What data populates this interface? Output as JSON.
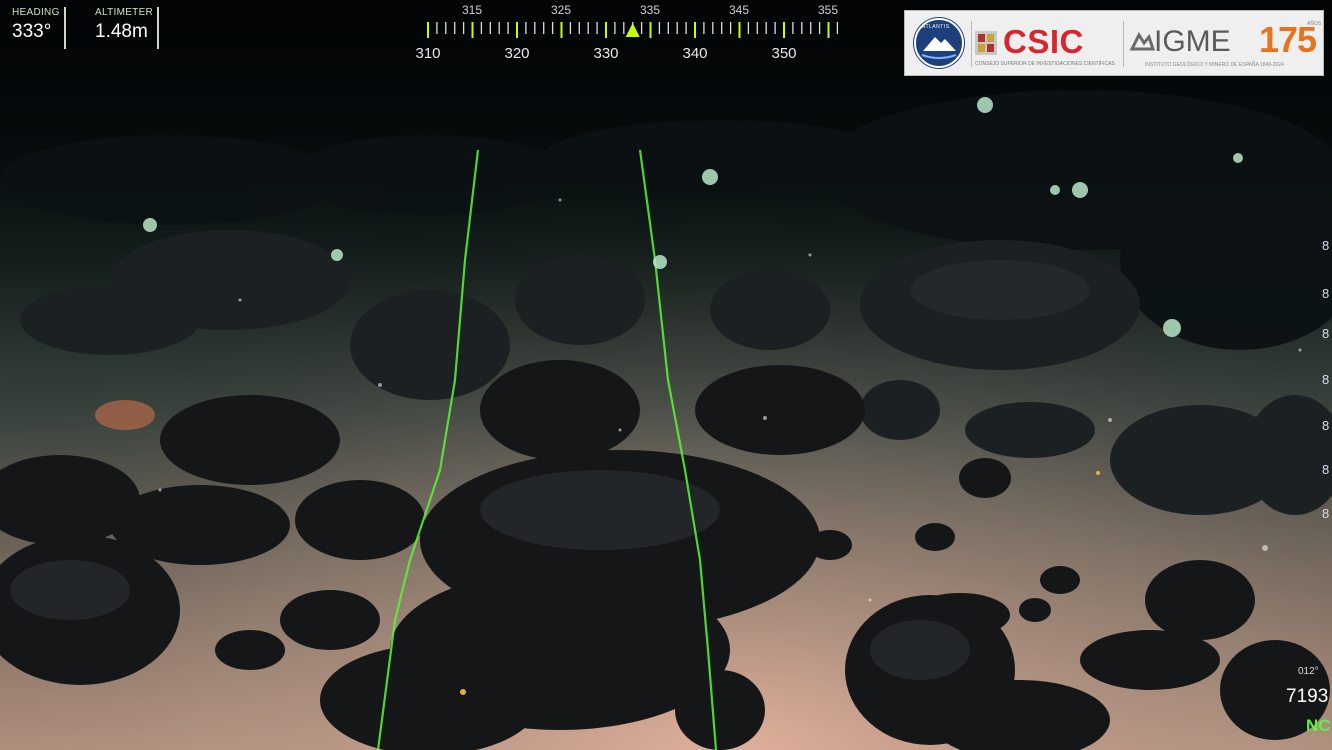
{
  "hud": {
    "heading_label": "HEADING",
    "heading_value": "333°",
    "altimeter_label": "ALTIMETER",
    "altimeter_value": "1.48m"
  },
  "compass": {
    "upper_labels": [
      "315",
      "325",
      "335",
      "345",
      "355"
    ],
    "lower_labels": [
      "310",
      "320",
      "330",
      "340",
      "350"
    ],
    "current_heading_deg": 333,
    "pointer_color": "#c6ff00"
  },
  "logos": {
    "atlantis": "ATLANTIS",
    "csic": "CSIC",
    "igme": "IGME",
    "igme_anniversary": "175",
    "csic_subtitle": "CONSEJO SUPERIOR DE INVESTIGACIONES CIENTÍFICAS",
    "igme_subtitle": "INSTITUTO GEOLÓGICO Y MINERO DE ESPAÑA  1849-2024",
    "igme_anios": "AÑOS"
  },
  "right_edge_marks": [
    "8",
    "8",
    "8",
    "8",
    "8",
    "8",
    "8"
  ],
  "bottom_right": {
    "small": "012°",
    "number": "7193",
    "status": "NC"
  },
  "colors": {
    "hud_green": "#c6ff00",
    "laser_green": "#4cff3a",
    "csic_red": "#d8262f",
    "igme_orange": "#e8731c"
  }
}
